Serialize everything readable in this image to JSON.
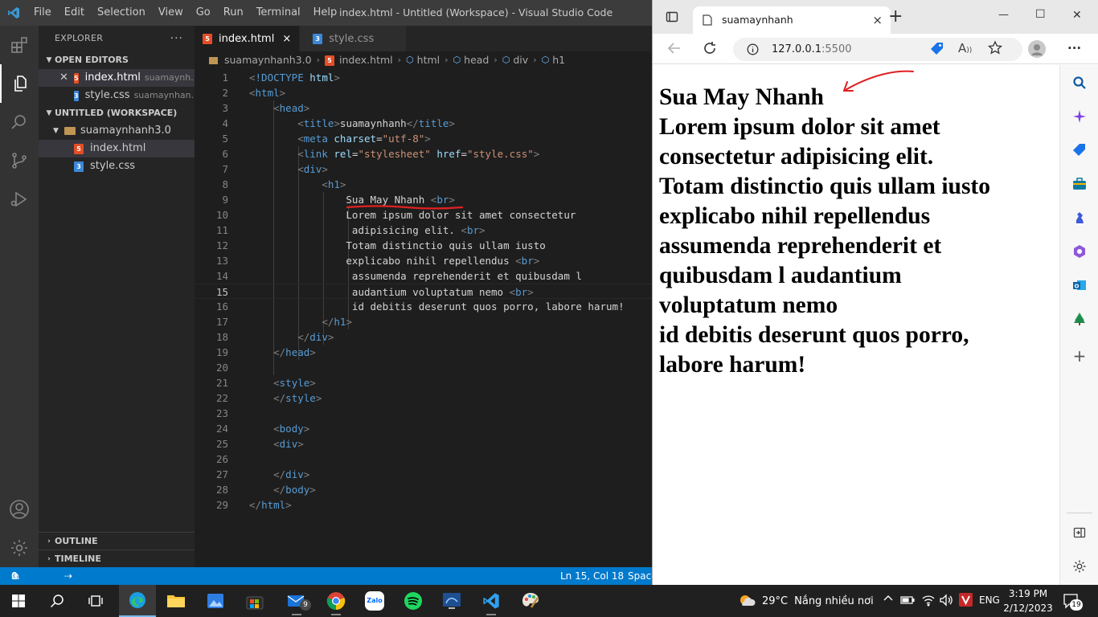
{
  "vscode": {
    "menu": [
      "File",
      "Edit",
      "Selection",
      "View",
      "Go",
      "Run",
      "Terminal",
      "Help"
    ],
    "window_title": "index.html - Untitled (Workspace) - Visual Studio Code",
    "explorer": {
      "title": "EXPLORER",
      "more": "···",
      "open_editors_label": "OPEN EDITORS",
      "open_editors": [
        {
          "name": "index.html",
          "path": "suamaynh...",
          "type": "html"
        },
        {
          "name": "style.css",
          "path": "suamaynhan...",
          "type": "css"
        }
      ],
      "workspace_label": "UNTITLED (WORKSPACE)",
      "folder": "suamaynhanh3.0",
      "files": [
        {
          "name": "index.html",
          "type": "html"
        },
        {
          "name": "style.css",
          "type": "css"
        }
      ],
      "outline_label": "OUTLINE",
      "timeline_label": "TIMELINE"
    },
    "tabs": [
      {
        "label": "index.html",
        "type": "html",
        "close": "×"
      },
      {
        "label": "style.css",
        "type": "css"
      }
    ],
    "breadcrumb": [
      "suamaynhanh3.0",
      "index.html",
      "html",
      "head",
      "div",
      "h1"
    ],
    "current_line": 15,
    "code_lines": [
      "<!DOCTYPE html>",
      "<html>",
      "    <head>",
      "        <title>suamaynhanh</title>",
      "        <meta charset=\"utf-8\">",
      "        <link rel=\"stylesheet\" href=\"style.css\">",
      "        <div>",
      "            <h1>",
      "                Sua May Nhanh <br>",
      "                Lorem ipsum dolor sit amet consectetur",
      "                 adipisicing elit. <br>",
      "                Totam distinctio quis ullam iusto",
      "                explicabo nihil repellendus <br>",
      "                 assumenda reprehenderit et quibusdam l",
      "                 audantium voluptatum nemo <br>",
      "                 id debitis deserunt quos porro, labore harum!",
      "            </h1>",
      "        </div>",
      "    </head>",
      "",
      "    <style>",
      "    </style>",
      "",
      "    <body>",
      "    <div>",
      "",
      "    </div>",
      "    </body>",
      "</html>"
    ],
    "status": {
      "errors": "0",
      "warnings": "0",
      "position": "Ln 15, Col 18",
      "spaces": "Space"
    }
  },
  "browser": {
    "tab_title": "suamaynhanh",
    "tab_close": "×",
    "new_tab": "+",
    "url_host": "127.0.0.1",
    "url_port": ":5500",
    "win_minimize": "—",
    "win_maximize": "☐",
    "win_close": "✕",
    "more": "···",
    "page_h1_lines": [
      "Sua May Nhanh",
      "Lorem ipsum dolor sit amet",
      "consectetur adipisicing elit.",
      "Totam distinctio quis ullam iusto",
      "explicabo nihil repellendus",
      "assumenda reprehenderit et",
      "quibusdam l audantium",
      "voluptatum nemo",
      "id debitis deserunt quos porro,",
      "labore harum!"
    ]
  },
  "taskbar": {
    "weather_temp": "29°C",
    "weather_text": "Nắng nhiều nơi",
    "language": "ENG",
    "time": "3:19 PM",
    "date": "2/12/2023",
    "notification_count": "19",
    "mail_badge": "9",
    "zalo_label": "Zalo"
  },
  "colors": {
    "vscode_accent": "#007acc",
    "annotation_red": "#e02020",
    "edge_blue": "#0c59a4"
  }
}
